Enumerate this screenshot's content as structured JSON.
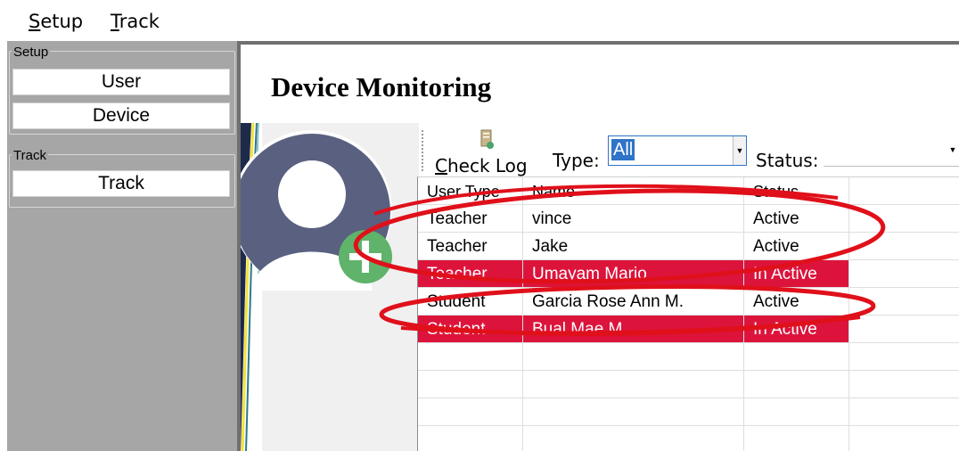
{
  "menu": [
    {
      "key": "S",
      "rest": "etup"
    },
    {
      "key": "T",
      "rest": "rack"
    }
  ],
  "sidebar": {
    "groups": [
      {
        "legend": "Setup",
        "buttons": [
          "User",
          "Device"
        ]
      },
      {
        "legend": "Track",
        "buttons": [
          "Track"
        ]
      }
    ]
  },
  "main": {
    "title": "Device Monitoring",
    "toolbar": {
      "check_log_key": "C",
      "check_log_rest": "heck Log",
      "type_label": "Type:",
      "type_value": "All",
      "status_label": "Status:",
      "status_value": ""
    }
  },
  "grid": {
    "columns": [
      "User Type",
      "Name",
      "Status"
    ],
    "rows": [
      {
        "user_type": "Teacher",
        "name": "vince",
        "status": "Active"
      },
      {
        "user_type": "Teacher",
        "name": "Jake",
        "status": "Active"
      },
      {
        "user_type": "Teacher",
        "name": "Umayam Mario",
        "status": "In Active"
      },
      {
        "user_type": "Student",
        "name": "Garcia Rose Ann M.",
        "status": "Active"
      },
      {
        "user_type": "Student",
        "name": "Bual Mae M.",
        "status": "In Active"
      }
    ]
  },
  "colors": {
    "inactive_row": "#dc143c",
    "annotation": "#e0101a",
    "selection": "#2f74c8",
    "avatar": "#5a6080",
    "add_badge": "#5fb36a"
  },
  "icons": {
    "check_log": "document-icon",
    "avatar": "user-silhouette-icon",
    "add": "plus-circle-icon"
  }
}
